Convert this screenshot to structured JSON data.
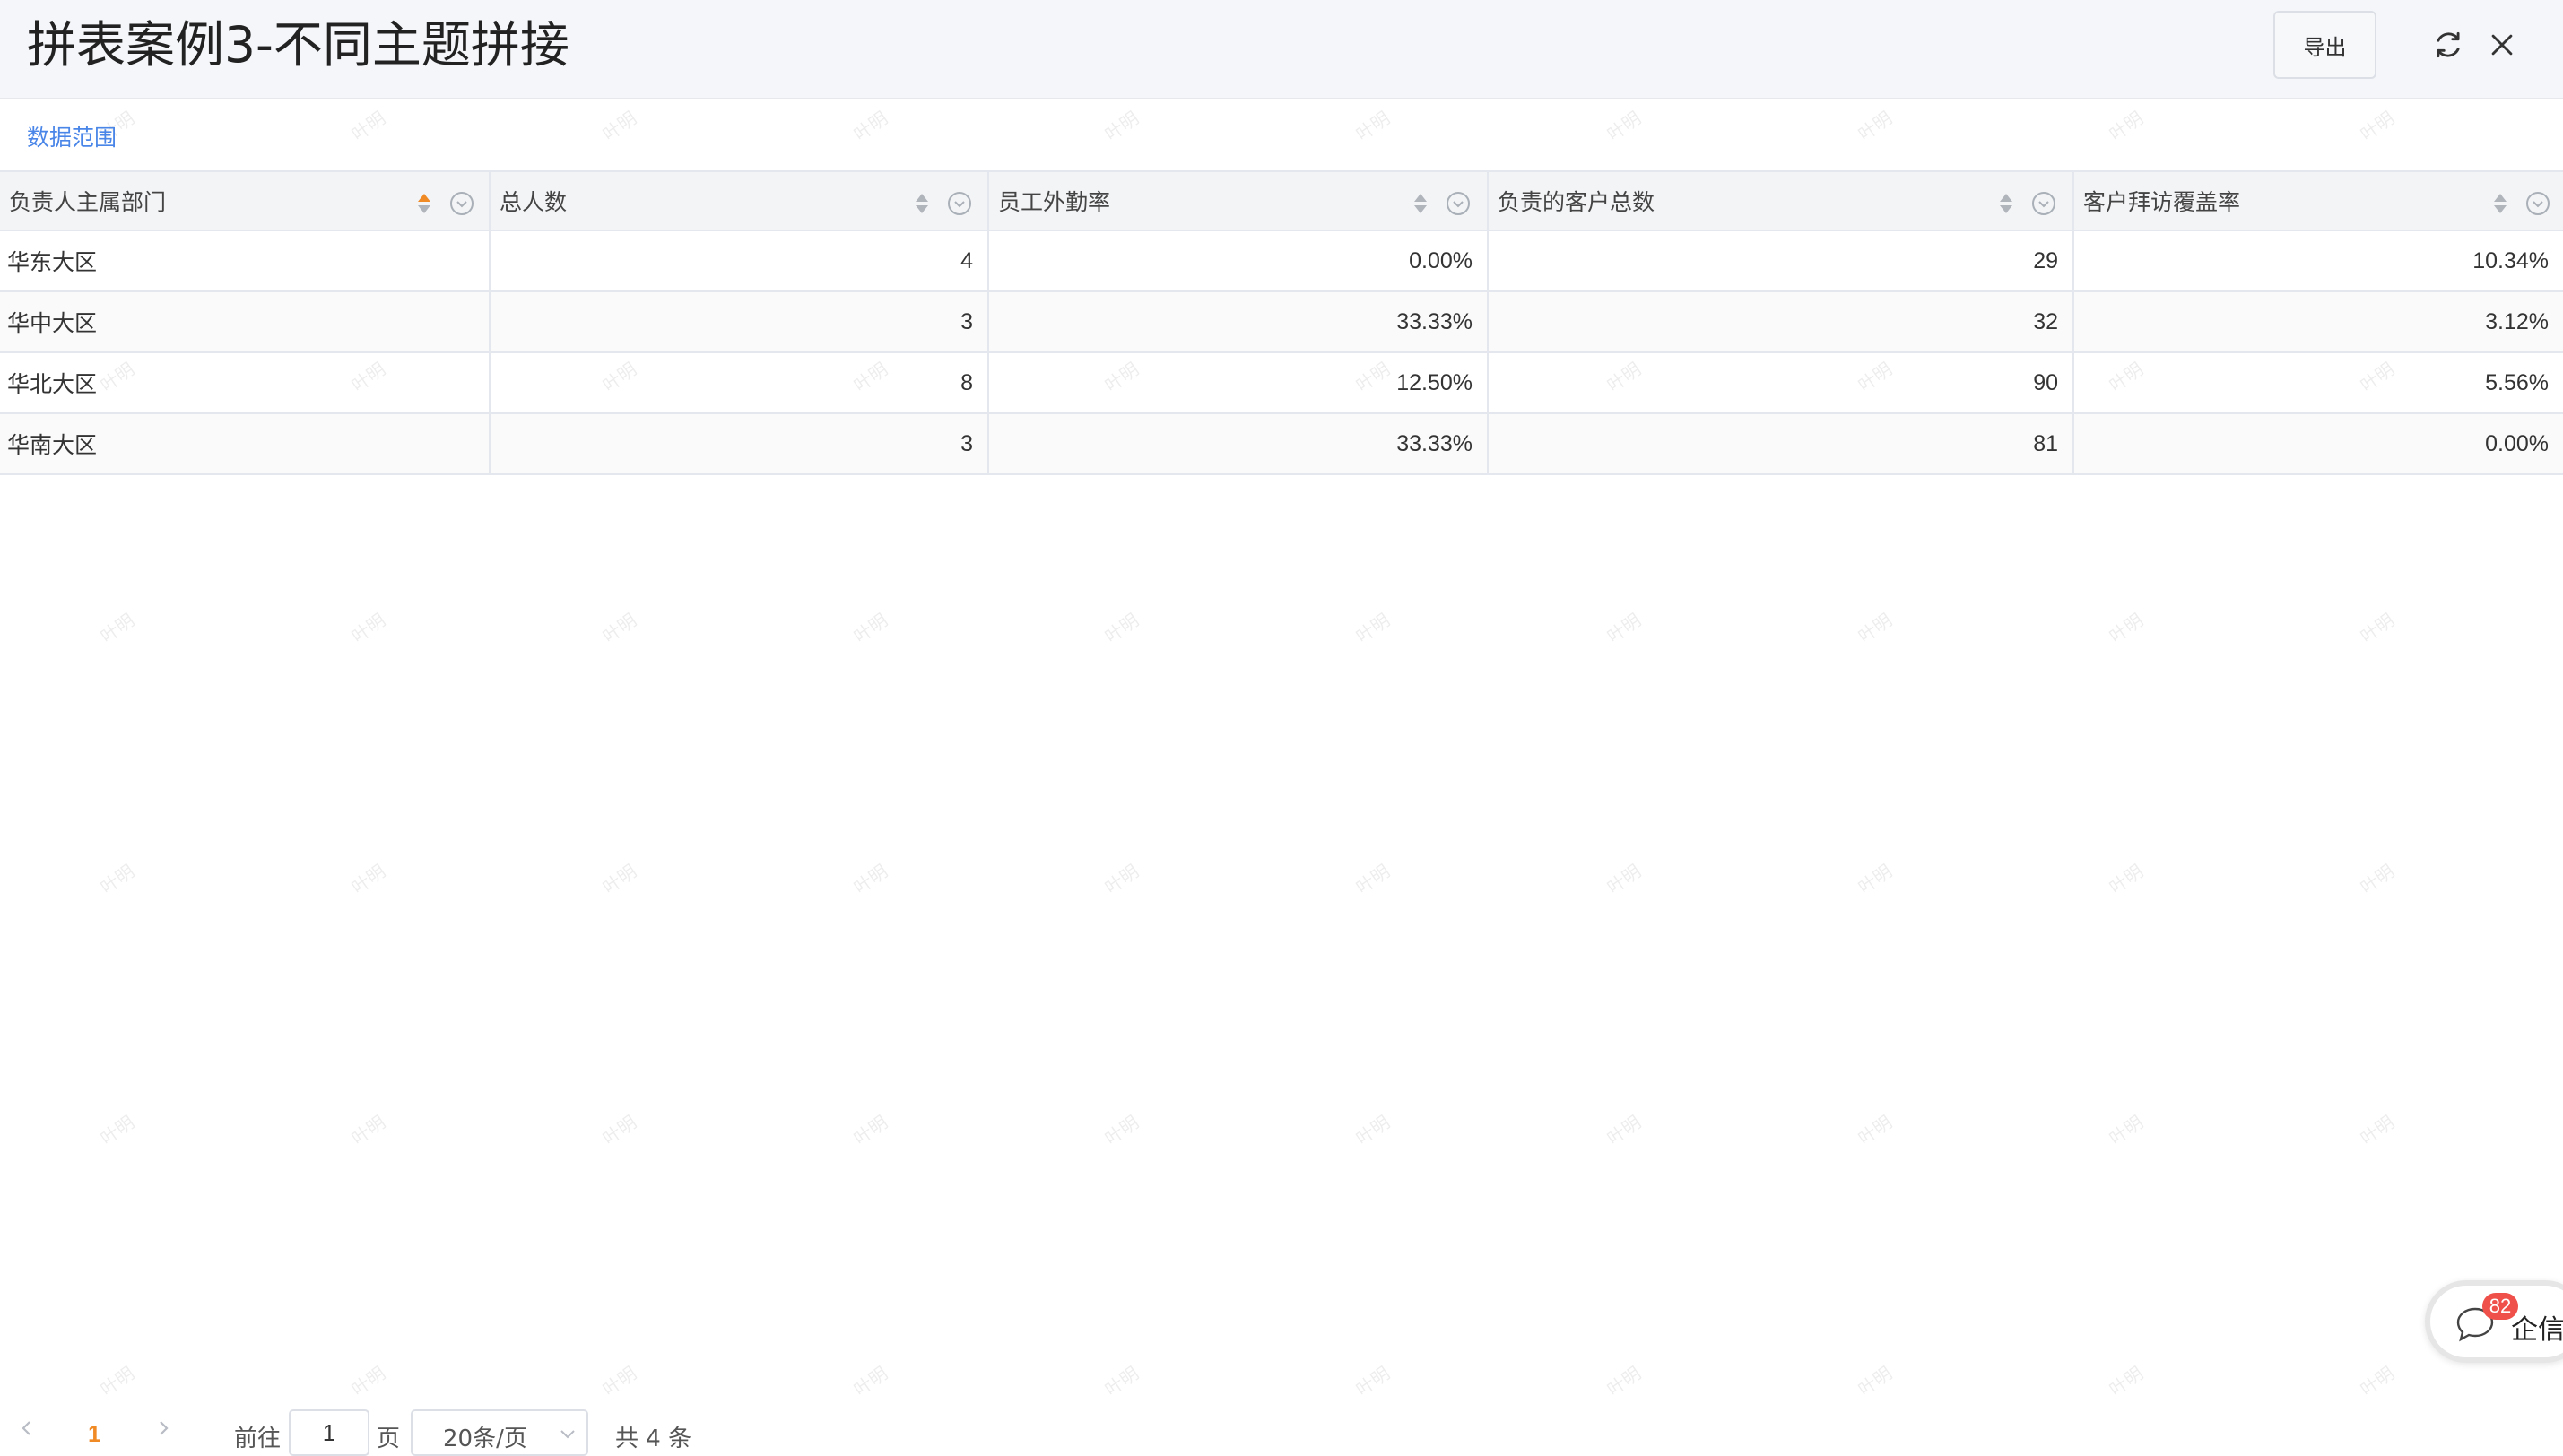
{
  "header": {
    "title": "拼表案例3-不同主题拼接",
    "export_label": "导出",
    "icons": [
      "refresh-icon",
      "close-icon"
    ]
  },
  "scope_link": "数据范围",
  "table": {
    "columns": [
      "负责人主属部门",
      "总人数",
      "员工外勤率",
      "负责的客户总数",
      "客户拜访覆盖率"
    ],
    "rows": [
      [
        "华东大区",
        "4",
        "0.00%",
        "29",
        "10.34%"
      ],
      [
        "华中大区",
        "3",
        "33.33%",
        "32",
        "3.12%"
      ],
      [
        "华北大区",
        "8",
        "12.50%",
        "90",
        "5.56%"
      ],
      [
        "华南大区",
        "3",
        "33.33%",
        "81",
        "0.00%"
      ]
    ],
    "sort_active_color": "#f08a24"
  },
  "pager": {
    "current_page": "1",
    "goto_label": "前往",
    "goto_value": "1",
    "page_unit": "页",
    "page_size": "20条/页",
    "total": "共 4 条"
  },
  "chat": {
    "badge": "82",
    "label": "企信"
  },
  "watermark_text": "叶明"
}
